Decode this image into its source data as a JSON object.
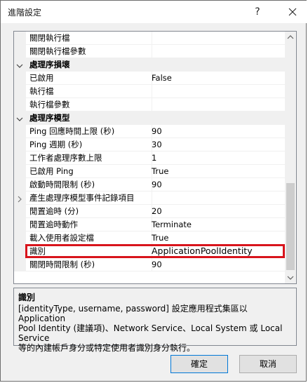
{
  "window": {
    "title": "進階設定",
    "help_label": "?"
  },
  "grid": {
    "rows": [
      {
        "type": "prop",
        "name": "關閉執行檔",
        "value": ""
      },
      {
        "type": "prop",
        "name": "關閉執行檔參數",
        "value": ""
      },
      {
        "type": "category",
        "name": "處理序損壞",
        "expanded": true
      },
      {
        "type": "prop",
        "name": "已啟用",
        "value": "False"
      },
      {
        "type": "prop",
        "name": "執行檔",
        "value": ""
      },
      {
        "type": "prop",
        "name": "執行檔參數",
        "value": ""
      },
      {
        "type": "category",
        "name": "處理序模型",
        "expanded": true
      },
      {
        "type": "prop",
        "name": "Ping 回應時間上限 (秒)",
        "value": "90"
      },
      {
        "type": "prop",
        "name": "Ping 週期 (秒)",
        "value": "30"
      },
      {
        "type": "prop",
        "name": "工作者處理序數上限",
        "value": "1"
      },
      {
        "type": "prop",
        "name": "已啟用 Ping",
        "value": "True"
      },
      {
        "type": "prop",
        "name": "啟動時間限制 (秒)",
        "value": "90"
      },
      {
        "type": "prop",
        "name": "產生處理序模型事件記錄項目",
        "value": "",
        "collapsible": true
      },
      {
        "type": "prop",
        "name": "閒置逾時 (分)",
        "value": "20"
      },
      {
        "type": "prop",
        "name": "閒置逾時動作",
        "value": "Terminate"
      },
      {
        "type": "prop",
        "name": "載入使用者設定檔",
        "value": "True"
      },
      {
        "type": "prop",
        "name": "識別",
        "value": "ApplicationPoolIdentity",
        "selected": true
      },
      {
        "type": "prop",
        "name": "關閉時間限制 (秒)",
        "value": "90"
      }
    ]
  },
  "description": {
    "title": "識別",
    "line1": "[identityType, username, password] 設定應用程式集區以 Application",
    "line2": "Pool Identity (建議項)、Network Service、Local System 或 Local Service",
    "line3": "等的內建帳戶身分或特定使用者識別身分執行。"
  },
  "buttons": {
    "ok_label": "確定",
    "cancel_label": "取消"
  },
  "colors": {
    "highlight": "#d8141c",
    "category_bg": "#f0f0f0"
  }
}
